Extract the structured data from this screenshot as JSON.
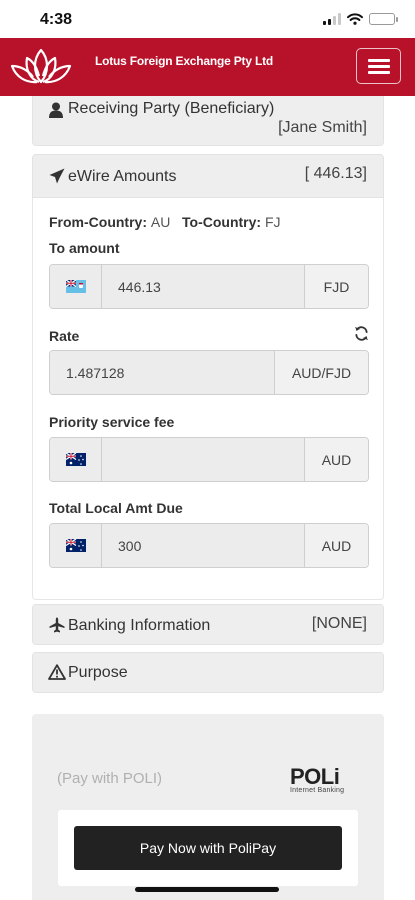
{
  "status_bar": {
    "time": "4:38"
  },
  "header": {
    "brand": "Lotus Foreign Exchange Pty Ltd",
    "brand_color": "#b8122a"
  },
  "receiving_party": {
    "title": "Receiving Party (Beneficiary)",
    "value": "[Jane Smith]",
    "icon": "user-icon"
  },
  "ewire": {
    "title": "eWire Amounts",
    "value": "[ 446.13]",
    "icon": "paper-plane-icon",
    "from_country_label": "From-Country:",
    "from_country": "AU",
    "to_country_label": "To-Country:",
    "to_country": "FJ",
    "to_amount_label": "To amount",
    "to_amount": "446.13",
    "to_currency": "FJD",
    "rate_label": "Rate",
    "rate": "1.487128",
    "rate_currency": "AUD/FJD",
    "priority_fee_label": "Priority service fee",
    "priority_fee": "",
    "priority_fee_currency": "AUD",
    "total_label": "Total Local Amt Due",
    "total": "300",
    "total_currency": "AUD"
  },
  "banking": {
    "title": "Banking Information",
    "value": "[NONE]",
    "icon": "plane-icon"
  },
  "purpose": {
    "title": "Purpose",
    "icon": "warning-icon"
  },
  "poli": {
    "pay_with_label": "(Pay with POLI)",
    "logo_text": "POLi",
    "logo_subtext": "Internet Banking",
    "button_label": "Pay Now with PoliPay"
  }
}
